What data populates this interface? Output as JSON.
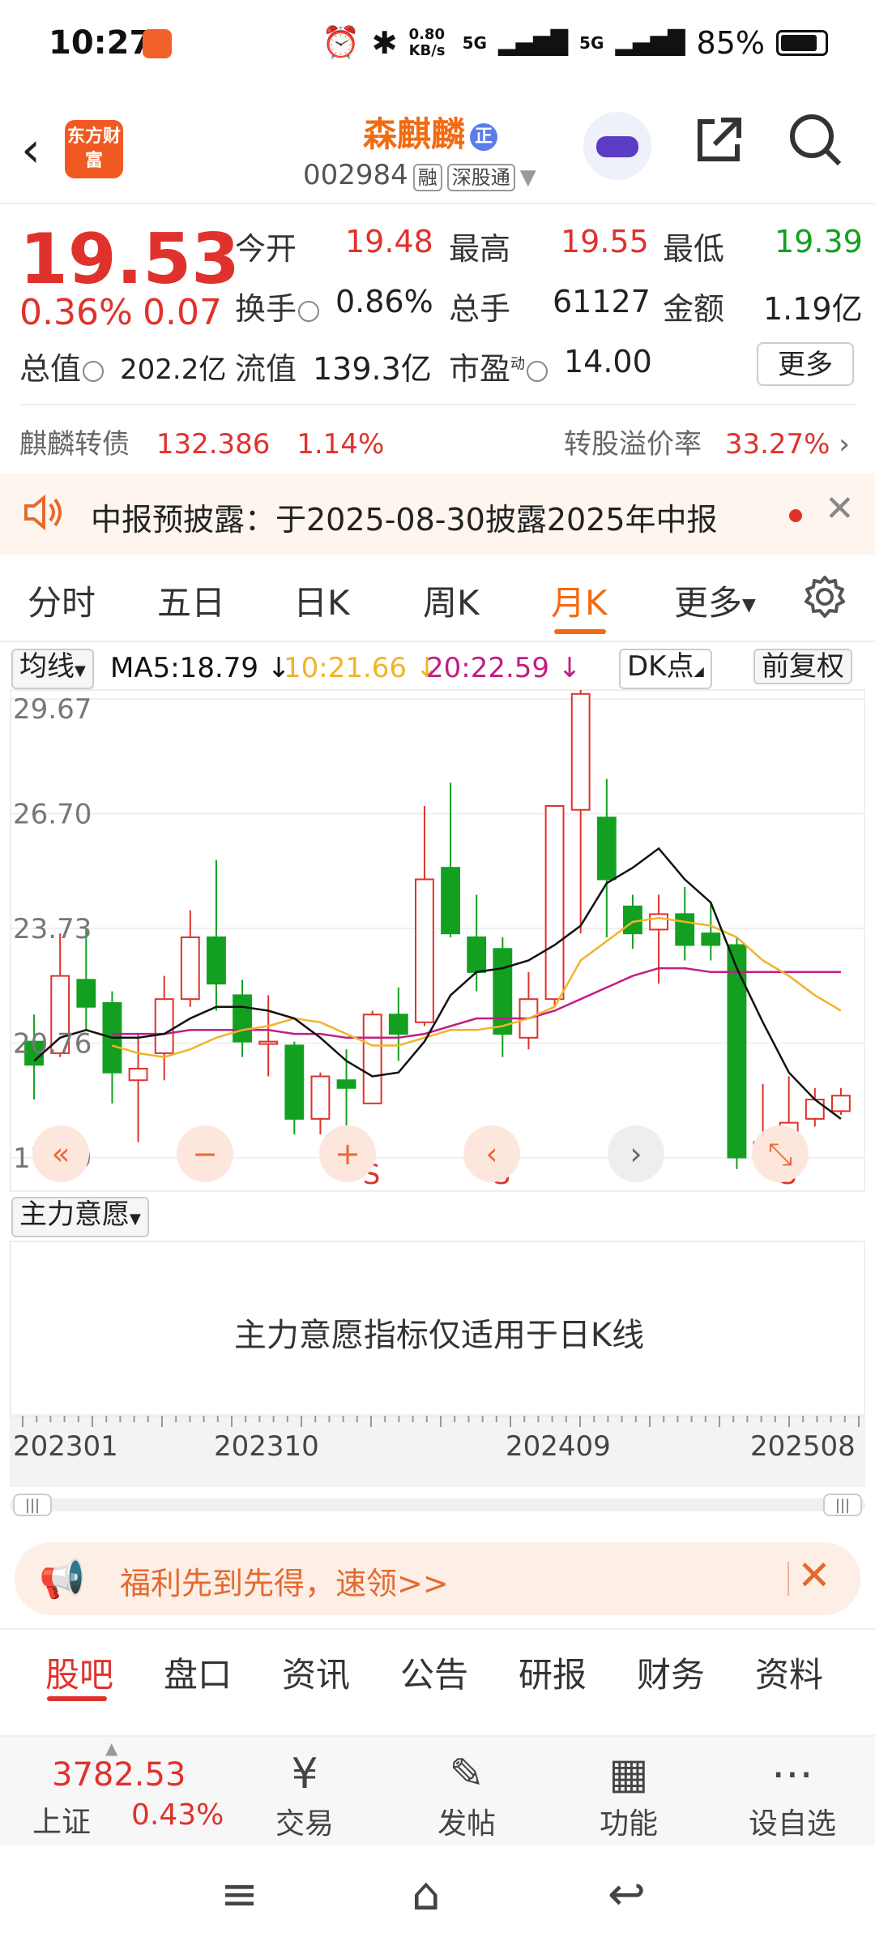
{
  "status": {
    "time": "10:27",
    "net_speed": "0.80 KB/s",
    "sim1": "5G",
    "sim2": "5G",
    "battery": "85%"
  },
  "header": {
    "back_icon": "chevron-left",
    "logo_text": "东方财富",
    "stock_name": "森麒麟",
    "badge": "正",
    "stock_code": "002984",
    "tags": [
      "融",
      "深股通"
    ],
    "share_icon": "share",
    "search_icon": "search"
  },
  "quote": {
    "price": "19.53",
    "change_pct": "0.36%",
    "change_abs": "0.07",
    "open_label": "今开",
    "open": "19.48",
    "high_label": "最高",
    "high": "19.55",
    "low_label": "最低",
    "low": "19.39",
    "turnover_label": "换手",
    "turnover": "0.86%",
    "volume_label": "总手",
    "volume": "61127",
    "amount_label": "金额",
    "amount": "1.19亿",
    "mktcap_label": "总值",
    "mktcap": "202.2亿",
    "float_label": "流值",
    "float_cap": "139.3亿",
    "pe_label": "市盈",
    "pe_sup": "动",
    "pe": "14.00",
    "more": "更多"
  },
  "bond": {
    "name": "麒麟转债",
    "price": "132.386",
    "pct": "1.14%",
    "premium_label": "转股溢价率",
    "premium": "33.27%"
  },
  "notice": {
    "text": "中报预披露：于2025-08-30披露2025年中报"
  },
  "chart_tabs": [
    "分时",
    "五日",
    "日K",
    "周K",
    "月K",
    "更多"
  ],
  "active_tab": "月K",
  "indicator": {
    "select": "均线",
    "ma5": "MA5:18.79 ↓",
    "ma10": "10:21.66 ↓",
    "ma20": "20:22.59 ↓",
    "dk": "DK点",
    "adj": "前复权"
  },
  "colors": {
    "up": "#e0322c",
    "down": "#13a020",
    "ma5": "#111111",
    "ma10": "#f0b429",
    "ma20": "#c21d84",
    "accent": "#f26b12"
  },
  "chart_data": {
    "type": "candlestick",
    "y_ticks": [
      "29.67",
      "26.70",
      "23.73",
      "20.76",
      "17.79"
    ],
    "ylim": [
      17.79,
      29.67
    ],
    "x_labels": [
      "202301",
      "202310",
      "202409",
      "202508"
    ],
    "candles": [
      {
        "o": 20.8,
        "c": 20.2,
        "h": 21.5,
        "l": 19.3
      },
      {
        "o": 20.5,
        "c": 22.5,
        "h": 23.6,
        "l": 20.4
      },
      {
        "o": 22.4,
        "c": 21.7,
        "h": 23.7,
        "l": 21.1
      },
      {
        "o": 21.8,
        "c": 20.0,
        "h": 22.1,
        "l": 19.2
      },
      {
        "o": 19.8,
        "c": 20.1,
        "h": 21.0,
        "l": 18.2
      },
      {
        "o": 20.5,
        "c": 21.9,
        "h": 22.5,
        "l": 19.8
      },
      {
        "o": 21.9,
        "c": 23.5,
        "h": 24.2,
        "l": 21.7
      },
      {
        "o": 23.5,
        "c": 22.3,
        "h": 25.5,
        "l": 21.6
      },
      {
        "o": 22.0,
        "c": 20.8,
        "h": 22.4,
        "l": 20.4
      },
      {
        "o": 20.8,
        "c": 20.8,
        "h": 22.0,
        "l": 19.9
      },
      {
        "o": 20.7,
        "c": 18.8,
        "h": 20.8,
        "l": 18.4
      },
      {
        "o": 18.8,
        "c": 19.9,
        "h": 20.0,
        "l": 18.4
      },
      {
        "o": 19.8,
        "c": 19.6,
        "h": 20.6,
        "l": 18.5
      },
      {
        "o": 19.2,
        "c": 21.5,
        "h": 21.6,
        "l": 19.2
      },
      {
        "o": 21.5,
        "c": 21.0,
        "h": 22.2,
        "l": 20.3
      },
      {
        "o": 21.3,
        "c": 25.0,
        "h": 26.9,
        "l": 21.2
      },
      {
        "o": 25.3,
        "c": 23.6,
        "h": 27.5,
        "l": 23.5
      },
      {
        "o": 23.5,
        "c": 22.6,
        "h": 24.6,
        "l": 22.1
      },
      {
        "o": 23.2,
        "c": 21.0,
        "h": 23.5,
        "l": 20.4
      },
      {
        "o": 20.9,
        "c": 21.9,
        "h": 22.6,
        "l": 20.6
      },
      {
        "o": 21.9,
        "c": 26.9,
        "h": 26.9,
        "l": 21.7
      },
      {
        "o": 26.8,
        "c": 29.8,
        "h": 29.9,
        "l": 23.6
      },
      {
        "o": 26.6,
        "c": 25.0,
        "h": 27.6,
        "l": 23.5
      },
      {
        "o": 24.3,
        "c": 23.6,
        "h": 24.6,
        "l": 23.2
      },
      {
        "o": 23.7,
        "c": 24.1,
        "h": 24.6,
        "l": 22.3
      },
      {
        "o": 24.1,
        "c": 23.3,
        "h": 24.8,
        "l": 22.9
      },
      {
        "o": 23.6,
        "c": 23.3,
        "h": 24.4,
        "l": 22.9
      },
      {
        "o": 23.3,
        "c": 17.8,
        "h": 23.5,
        "l": 17.5
      },
      {
        "o": 17.9,
        "c": 18.2,
        "h": 19.7,
        "l": 17.9
      },
      {
        "o": 18.3,
        "c": 18.7,
        "h": 19.9,
        "l": 18.1
      },
      {
        "o": 18.8,
        "c": 19.3,
        "h": 19.6,
        "l": 18.6
      },
      {
        "o": 19.0,
        "c": 19.4,
        "h": 19.6,
        "l": 18.9
      }
    ],
    "ma5": [
      20.3,
      20.9,
      21.1,
      20.9,
      20.9,
      21.0,
      21.4,
      21.7,
      21.7,
      21.6,
      21.4,
      20.9,
      20.3,
      19.9,
      20.0,
      20.8,
      22.0,
      22.6,
      22.7,
      22.9,
      23.3,
      23.8,
      24.9,
      25.3,
      25.8,
      25.0,
      24.4,
      22.7,
      21.3,
      20.0,
      19.3,
      18.8
    ],
    "ma10": [
      null,
      null,
      null,
      20.7,
      20.5,
      20.4,
      20.6,
      20.9,
      21.1,
      21.2,
      21.4,
      21.3,
      21.0,
      20.7,
      20.7,
      20.9,
      21.1,
      21.1,
      21.2,
      21.4,
      21.7,
      22.9,
      23.4,
      23.9,
      24.0,
      23.9,
      23.8,
      23.5,
      22.9,
      22.5,
      22.0,
      21.6
    ],
    "ma20": [
      null,
      null,
      null,
      21.0,
      21.0,
      21.0,
      21.1,
      21.1,
      21.1,
      21.1,
      21.0,
      21.0,
      20.9,
      20.9,
      20.9,
      21.0,
      21.2,
      21.4,
      21.4,
      21.4,
      21.6,
      21.9,
      22.2,
      22.5,
      22.7,
      22.7,
      22.6,
      22.6,
      22.6,
      22.6,
      22.6,
      22.6
    ],
    "markers": [
      "S",
      "S",
      "S"
    ]
  },
  "mainforce": {
    "select": "主力意愿",
    "message": "主力意愿指标仅适用于日K线"
  },
  "promo": {
    "text": "福利先到先得，速领>>"
  },
  "bottom_tabs": [
    "股吧",
    "盘口",
    "资讯",
    "公告",
    "研报",
    "财务",
    "资料"
  ],
  "bottom_nav": {
    "index_value": "3782.53",
    "index_name": "上证",
    "index_pct": "0.43%",
    "trade": "交易",
    "post": "发帖",
    "func": "功能",
    "watch": "设自选"
  }
}
